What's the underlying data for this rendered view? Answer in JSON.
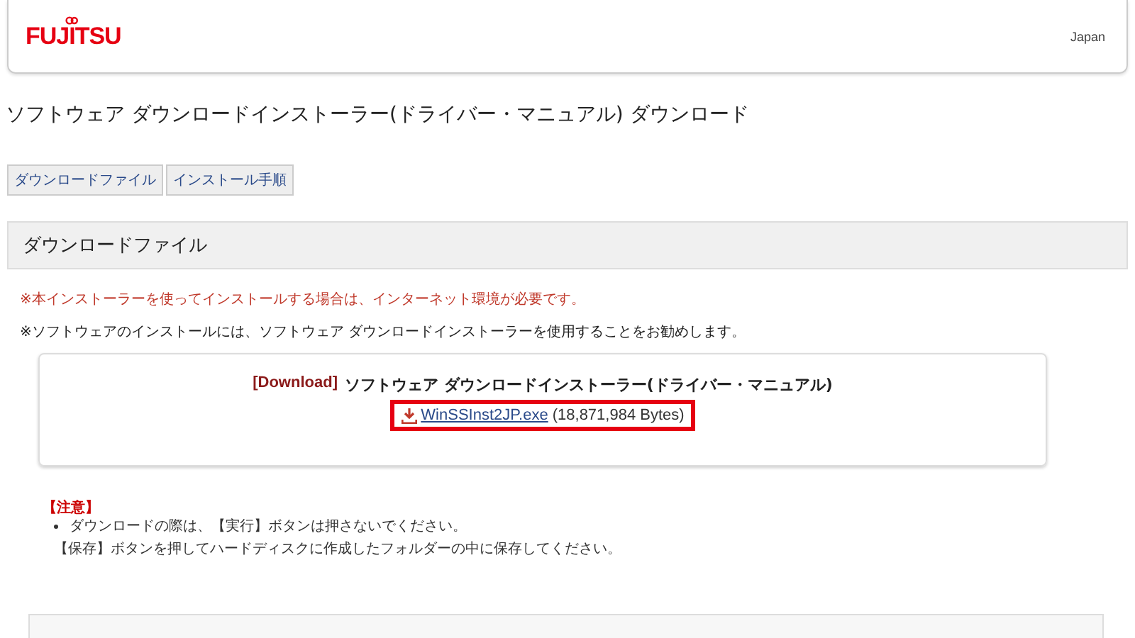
{
  "header": {
    "logo": "FUJITSU",
    "region": "Japan"
  },
  "title": "ソフトウェア ダウンロードインストーラー(ドライバー・マニュアル) ダウンロード",
  "tabs": [
    {
      "label": "ダウンロードファイル",
      "selected": false
    },
    {
      "label": "インストール手順",
      "selected": false
    }
  ],
  "section": {
    "heading": "ダウンロードファイル",
    "notices": [
      {
        "text": "※本インストーラーを使ってインストールする場合は、インターネット環境が必要です。",
        "kind": "warning"
      },
      {
        "text": "※ソフトウェアのインストールには、ソフトウェア ダウンロードインストーラーを使用することをお勧めします。",
        "kind": "info"
      }
    ],
    "download": {
      "tag": "[Download]",
      "name": "ソフトウェア ダウンロードインストーラー(ドライバー・マニュアル)",
      "file": "WinSSInst2JP.exe",
      "size": "(18,871,984 Bytes)",
      "highlighted": true
    },
    "caution": {
      "heading": "【注意】",
      "items": [
        {
          "lines": [
            "ダウンロードの際は、【実行】ボタンは押さないでください。",
            "【保存】ボタンを押してハードディスクに作成したフォルダーの中に保存してください。"
          ]
        }
      ]
    }
  }
}
